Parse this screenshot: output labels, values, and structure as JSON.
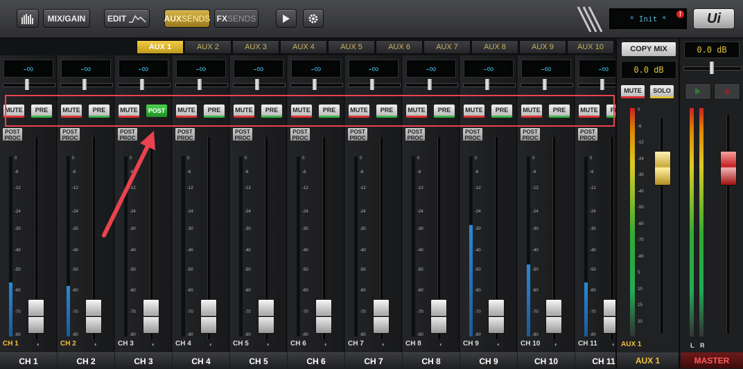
{
  "toolbar": {
    "mix_gain": "MIX/GAIN",
    "edit": "EDIT",
    "aux_sends_a": "AUX",
    "aux_sends_b": "SENDS",
    "fx_sends_a": "FX",
    "fx_sends_b": "SENDS",
    "status_text": "* Init *",
    "alert": "!",
    "logo": "Ui"
  },
  "aux_tabs": [
    "AUX 1",
    "AUX 2",
    "AUX 3",
    "AUX 4",
    "AUX 5",
    "AUX 6",
    "AUX 7",
    "AUX 8",
    "AUX 9",
    "AUX 10"
  ],
  "active_tab": 0,
  "channels": [
    {
      "short": "CH 1",
      "name": "CH 1",
      "send": "-∞",
      "mute": "MUTE",
      "tap": "PRE",
      "post_proc": "POST PROC",
      "color": "#f2c33a",
      "meter": 0.3
    },
    {
      "short": "CH 2",
      "name": "CH 2",
      "send": "-∞",
      "mute": "MUTE",
      "tap": "PRE",
      "post_proc": "POST PROC",
      "color": "#f2c33a",
      "meter": 0.28
    },
    {
      "short": "CH 3",
      "name": "CH 3",
      "send": "-∞",
      "mute": "MUTE",
      "tap": "POST",
      "post_proc": "POST PROC",
      "color": "#dddddd",
      "meter": 0.0
    },
    {
      "short": "CH 4",
      "name": "CH 4",
      "send": "-∞",
      "mute": "MUTE",
      "tap": "PRE",
      "post_proc": "POST PROC",
      "color": "#dddddd",
      "meter": 0.0
    },
    {
      "short": "CH 5",
      "name": "CH 5",
      "send": "-∞",
      "mute": "MUTE",
      "tap": "PRE",
      "post_proc": "POST PROC",
      "color": "#dddddd",
      "meter": 0.0
    },
    {
      "short": "CH 6",
      "name": "CH 6",
      "send": "-∞",
      "mute": "MUTE",
      "tap": "PRE",
      "post_proc": "POST PROC",
      "color": "#dddddd",
      "meter": 0.0
    },
    {
      "short": "CH 7",
      "name": "CH 7",
      "send": "-∞",
      "mute": "MUTE",
      "tap": "PRE",
      "post_proc": "POST PROC",
      "color": "#dddddd",
      "meter": 0.0
    },
    {
      "short": "CH 8",
      "name": "CH 8",
      "send": "-∞",
      "mute": "MUTE",
      "tap": "PRE",
      "post_proc": "POST PROC",
      "color": "#dddddd",
      "meter": 0.0
    },
    {
      "short": "CH 9",
      "name": "CH 9",
      "send": "-∞",
      "mute": "MUTE",
      "tap": "PRE",
      "post_proc": "POST PROC",
      "color": "#dddddd",
      "meter": 0.62
    },
    {
      "short": "CH 10",
      "name": "CH 10",
      "send": "-∞",
      "mute": "MUTE",
      "tap": "PRE",
      "post_proc": "POST PROC",
      "color": "#dddddd",
      "meter": 0.4
    },
    {
      "short": "CH 11",
      "name": "CH 11",
      "send": "-∞",
      "mute": "MUTE",
      "tap": "PRE",
      "post_proc": "POST PROC",
      "color": "#dddddd",
      "meter": 0.3
    }
  ],
  "meter_scale": [
    "0",
    "-6",
    "-12",
    "-24",
    "-30",
    "-40",
    "-50",
    "-60",
    "-70",
    "-80"
  ],
  "aux_master": {
    "copy_mix": "COPY MIX",
    "level": "0.0 dB",
    "mute": "MUTE",
    "solo": "SOLO",
    "short": "AUX 1",
    "name": "AUX 1",
    "scale": [
      "0",
      "-6",
      "-12",
      "-24",
      "-30",
      "-40",
      "-50",
      "-60",
      "-70",
      "-80",
      "5",
      "10",
      "15",
      "20"
    ]
  },
  "main": {
    "level": "0.0 dB",
    "lr": [
      "L",
      "R"
    ],
    "name": "MASTER"
  }
}
